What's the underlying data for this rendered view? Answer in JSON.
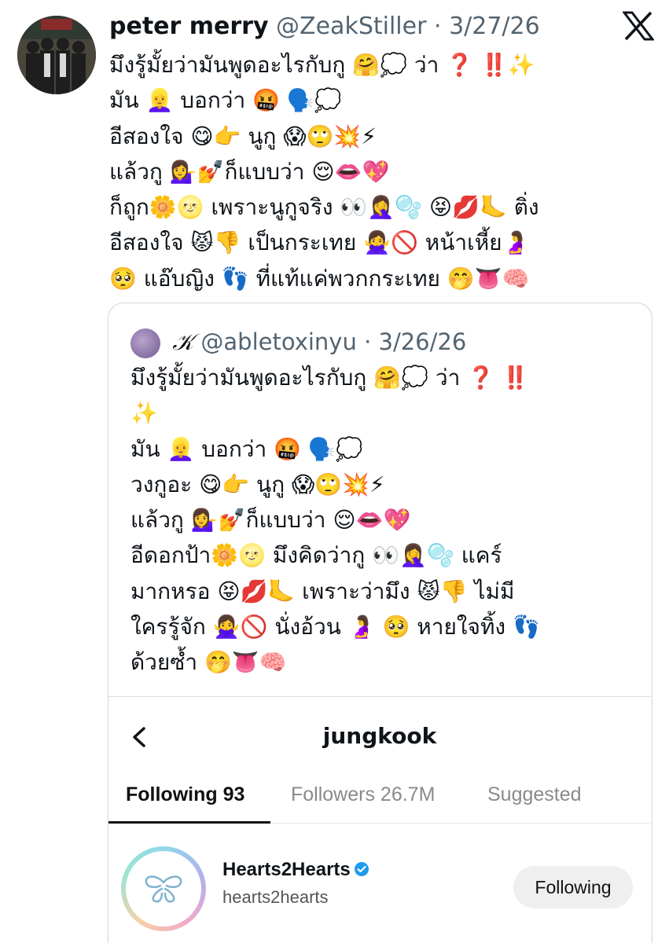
{
  "tweet": {
    "display_name": "peter merry",
    "handle": "@ZeakStiller",
    "separator": "·",
    "date": "3/27/26",
    "body": "มึงรู้มั้ยว่ามันพูดอะไรกับกู 🤗💭 ว่า ❓ ‼️✨\nมัน 👱‍♀️ บอกว่า 🤬 🗣️💭\nอีสองใจ 😋👉 นูกู 😱🙄💥⚡\nแล้วกู 💁‍♀️💅ก็แบบว่า 😌👄💖\nก็ถูก🌼🌝 เพราะนูกูจริง 👀🤦‍♀️🫧 😝💋🦶 ติ่ง\nอีสองใจ 😾👎 เป็นกระเทย 🙅‍♀️🚫 หน้าเหี้ย🤰\n🥺 แอ๊บญิง 👣 ที่แท้แค่พวกกระเทย 🤭👅🧠"
  },
  "quoted": {
    "display_name": "𝒦",
    "handle": "@abletoxinyu",
    "separator": "·",
    "date": "3/26/26",
    "body": "มึงรู้มั้ยว่ามันพูดอะไรกับกู 🤗💭 ว่า ❓ ‼️\n✨\nมัน 👱‍♀️ บอกว่า 🤬 🗣️💭\nวงกูอะ 😋👉 นูกู 😱🙄💥⚡\nแล้วกู 💁‍♀️💅ก็แบบว่า 😌👄💖\nอีดอกป้า🌼🌝 มึงคิดว่ากู 👀🤦‍♀️🫧 แคร์\nมากหรอ 😝💋🦶 เพราะว่ามึง 😾👎 ไม่มี\nใครรู้จัก 🙅‍♀️🚫 นั่งอ้วน 🤰 🥺 หายใจทิ้ง 👣\nด้วยซ้ำ 🤭👅🧠"
  },
  "embedded_screenshot": {
    "title": "jungkook",
    "tabs": [
      "Following 93",
      "Followers 26.7M",
      "Suggested"
    ],
    "active_tab": "Following 93",
    "user": {
      "name": "Hearts2Hearts",
      "handle": "hearts2hearts",
      "button": "Following"
    }
  },
  "icons": {
    "logo": "x-logo-icon",
    "back": "chevron-left-icon",
    "verified": "verified-badge-icon"
  },
  "colors": {
    "text": "#0f1419",
    "secondary": "#536471",
    "border": "#cfd9de",
    "verified": "#1d9bf0"
  }
}
